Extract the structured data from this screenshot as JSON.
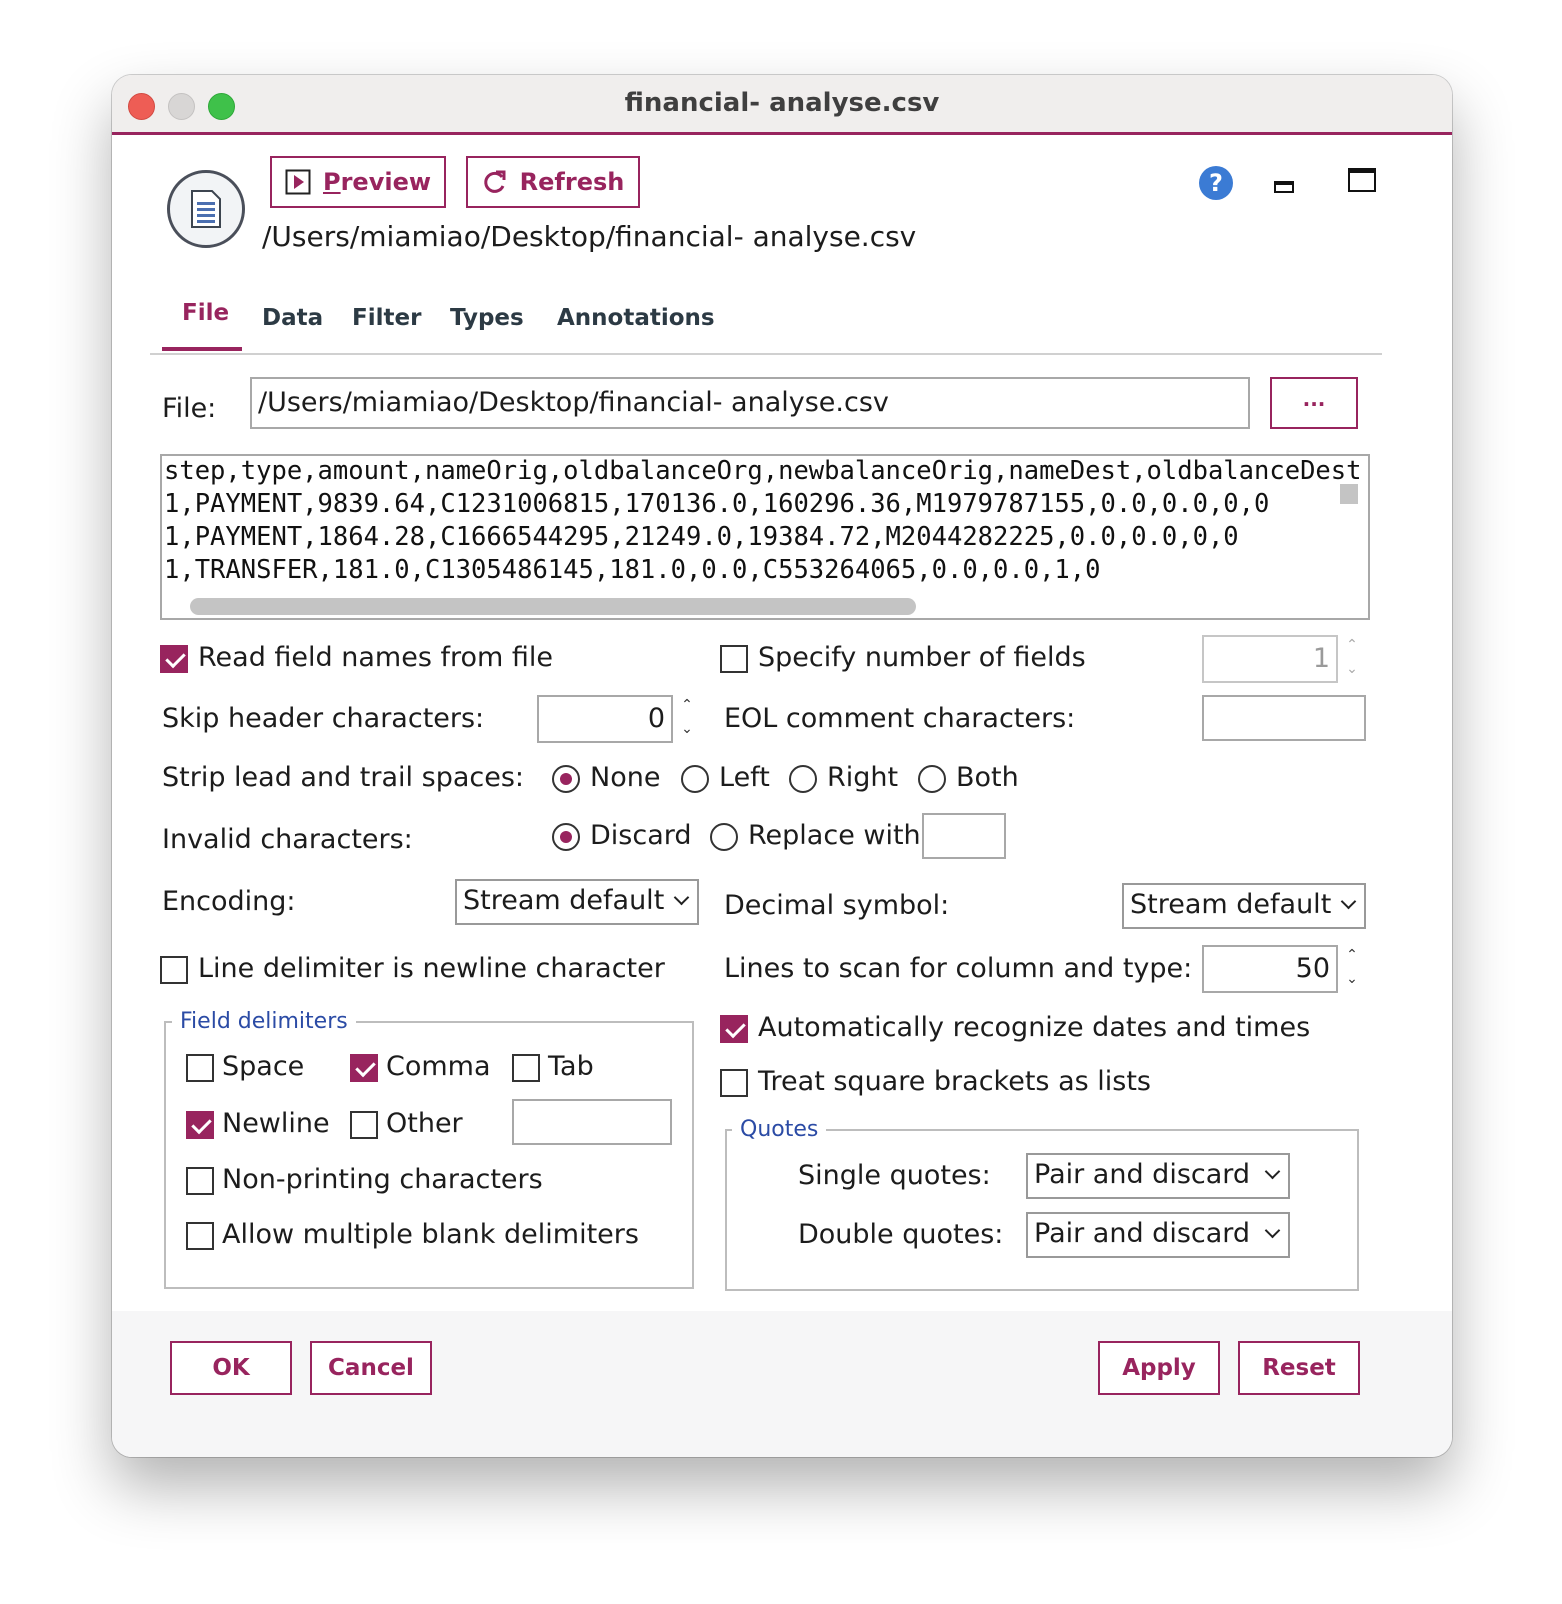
{
  "window": {
    "title": "financial- analyse.csv"
  },
  "toolbar": {
    "preview_label": "Preview",
    "refresh_label": "Refresh",
    "file_path": "/Users/miamiao/Desktop/financial- analyse.csv"
  },
  "tabs": [
    "File",
    "Data",
    "Filter",
    "Types",
    "Annotations"
  ],
  "file": {
    "label": "File:",
    "value": "/Users/miamiao/Desktop/financial- analyse.csv",
    "browse_label": "..."
  },
  "preview_lines": [
    "step,type,amount,nameOrig,oldbalanceOrg,newbalanceOrig,nameDest,oldbalanceDest",
    "1,PAYMENT,9839.64,C1231006815,170136.0,160296.36,M1979787155,0.0,0.0,0,0",
    "1,PAYMENT,1864.28,C1666544295,21249.0,19384.72,M2044282225,0.0,0.0,0,0",
    "1,TRANSFER,181.0,C1305486145,181.0,0.0,C553264065,0.0,0.0,1,0"
  ],
  "options": {
    "read_field_names": "Read field names from file",
    "specify_fields": "Specify number of fields",
    "num_fields": "1",
    "skip_header": "Skip header characters:",
    "skip_header_value": "0",
    "eol_comment": "EOL comment characters:",
    "eol_comment_value": "",
    "strip_spaces": "Strip lead and trail spaces:",
    "strip_none": "None",
    "strip_left": "Left",
    "strip_right": "Right",
    "strip_both": "Both",
    "invalid_chars": "Invalid characters:",
    "discard": "Discard",
    "replace_with": "Replace with",
    "replace_value": "",
    "encoding": "Encoding:",
    "encoding_value": "Stream default",
    "decimal_symbol": "Decimal symbol:",
    "decimal_value": "Stream default",
    "line_delimiter": "Line delimiter is newline character",
    "lines_to_scan": "Lines to scan for column and type:",
    "lines_to_scan_value": "50",
    "auto_dates": "Automatically recognize dates and times",
    "square_brackets": "Treat square brackets as lists"
  },
  "field_delimiters": {
    "title": "Field delimiters",
    "space": "Space",
    "comma": "Comma",
    "tab": "Tab",
    "newline": "Newline",
    "other": "Other",
    "other_value": "",
    "non_printing": "Non-printing characters",
    "multiple_blank": "Allow multiple blank delimiters"
  },
  "quotes": {
    "title": "Quotes",
    "single_label": "Single quotes:",
    "single_value": "Pair and discard",
    "double_label": "Double quotes:",
    "double_value": "Pair and discard"
  },
  "footer": {
    "ok": "OK",
    "cancel": "Cancel",
    "apply": "Apply",
    "reset": "Reset"
  },
  "colors": {
    "accent": "#98245e",
    "group_title": "#2b4ba5",
    "help": "#3b7bd4"
  }
}
